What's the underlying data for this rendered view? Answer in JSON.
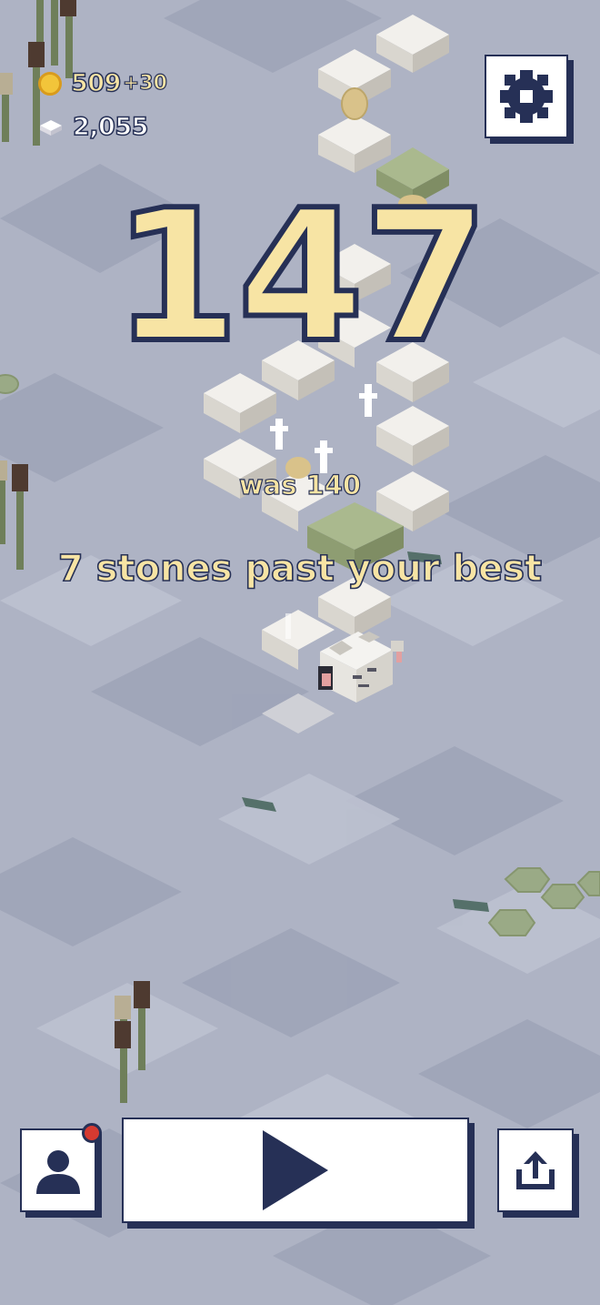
{
  "hud": {
    "coins": "509",
    "coin_bonus": "+30",
    "stones": "2,055"
  },
  "result": {
    "score": "147",
    "previous": "was 140",
    "message": "7 stones past your best"
  },
  "icons": {
    "coin": "coin-icon",
    "stone": "stone-cube-icon",
    "settings": "gear-icon",
    "profile": "person-icon",
    "play": "play-icon",
    "share": "share-icon"
  },
  "colors": {
    "text_fill": "#f7e4a4",
    "text_outline": "#263056",
    "water": "#aeb3c4",
    "notification": "#d63a31"
  }
}
